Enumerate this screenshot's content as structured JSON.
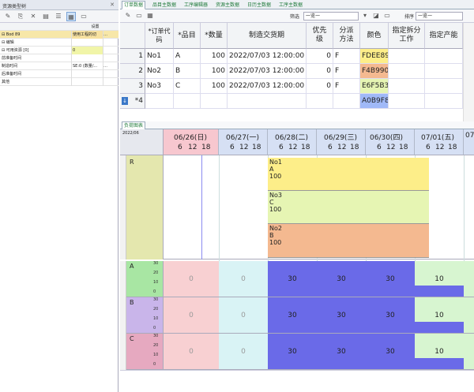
{
  "left_panel": {
    "title": "资源类型树",
    "close": "✕",
    "toolbar_icons": [
      "add-icon",
      "copy-icon",
      "delete-icon",
      "save-icon",
      "list-icon",
      "grid-icon",
      "view-icon"
    ],
    "column_header": "设置",
    "rows": [
      {
        "label": "⊟ Bod 89",
        "value": "使用工程的切换..",
        "highlight": true
      },
      {
        "label": "  ⊟ 编辑",
        "value": ""
      },
      {
        "label": "    ⊟ 可用资源 [0]",
        "value": "0",
        "yellow": true
      },
      {
        "label": "       前准备时间",
        "value": ""
      },
      {
        "label": "       制造时间",
        "value": "SE:0 (数量/..."
      },
      {
        "label": "       后准备时间",
        "value": ""
      },
      {
        "label": "       其他",
        "value": ""
      }
    ]
  },
  "tabs": [
    "订单数据",
    "品目主数据",
    "工序编辑器",
    "资源主数据",
    "日历主数据",
    "工序主数据"
  ],
  "toolbar": {
    "filter_label": "筛选",
    "filter_value": "一览一",
    "sort_label": "排序",
    "sort_value": "一览一"
  },
  "order_grid": {
    "headers": [
      "*订单代码",
      "*品目",
      "*数量",
      "制造交货期",
      "优先级",
      "分派方法",
      "颜色",
      "指定拆分工作",
      "指定产能"
    ],
    "rows": [
      {
        "num": "1",
        "code": "No1",
        "item": "A",
        "qty": "100",
        "due": "2022/07/03  12:00:00",
        "prio": "0",
        "method": "F",
        "color": "FDEE89",
        "color_hex": "#FDEE89"
      },
      {
        "num": "2",
        "code": "No2",
        "item": "B",
        "qty": "100",
        "due": "2022/07/03  12:00:00",
        "prio": "0",
        "method": "F",
        "color": "F4B990",
        "color_hex": "#F4B990"
      },
      {
        "num": "3",
        "code": "No3",
        "item": "C",
        "qty": "100",
        "due": "2022/07/03  12:00:00",
        "prio": "0",
        "method": "F",
        "color": "E6F5B3",
        "color_hex": "#E6F5B3"
      }
    ],
    "new_row": {
      "num": "*4",
      "color": "A0B9F8",
      "color_hex": "#A0B9F8"
    }
  },
  "gantt": {
    "tab": "负荷图表",
    "corner_label": "2022/06",
    "dates": [
      "06/26(日)",
      "06/27(一)",
      "06/28(二)",
      "06/29(三)",
      "06/30(四)",
      "07/01(五)",
      "07"
    ],
    "hours": [
      "6",
      "12",
      "18"
    ],
    "order_row_label": "R",
    "tasks": [
      {
        "code": "No1",
        "item": "A",
        "qty": "100",
        "color": "#FDEE89"
      },
      {
        "code": "No3",
        "item": "C",
        "qty": "100",
        "color": "#E6F5B3"
      },
      {
        "code": "No2",
        "item": "B",
        "qty": "100",
        "color": "#F4B990"
      }
    ],
    "resources": [
      {
        "name": "A",
        "color": "#a8e6a3",
        "values": [
          "0",
          "0",
          "30",
          "30",
          "30",
          "10"
        ]
      },
      {
        "name": "B",
        "color": "#c9b5ea",
        "values": [
          "0",
          "0",
          "30",
          "30",
          "30",
          "10"
        ]
      },
      {
        "name": "C",
        "color": "#e6a9c0",
        "values": [
          "0",
          "0",
          "30",
          "30",
          "30",
          "10"
        ]
      }
    ],
    "scale_ticks": [
      "30",
      "20",
      "10",
      "0"
    ]
  }
}
